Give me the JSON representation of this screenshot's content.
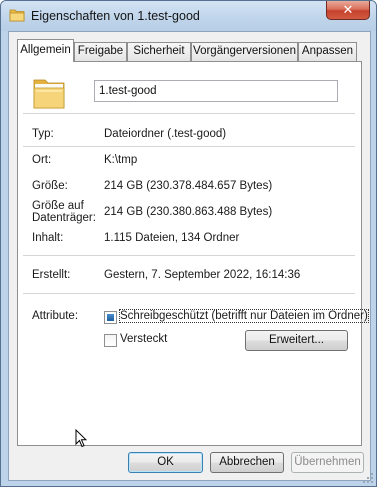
{
  "window": {
    "title": "Eigenschaften von 1.test-good",
    "close_glyph": "✕"
  },
  "tabs": [
    {
      "label": "Allgemein",
      "active": true
    },
    {
      "label": "Freigabe",
      "active": false
    },
    {
      "label": "Sicherheit",
      "active": false
    },
    {
      "label": "Vorgängerversionen",
      "active": false
    },
    {
      "label": "Anpassen",
      "active": false
    }
  ],
  "general": {
    "name_value": "1.test-good",
    "type_label": "Typ:",
    "type_value": "Dateiordner (.test-good)",
    "location_label": "Ort:",
    "location_value": "K:\\tmp",
    "size_label": "Größe:",
    "size_value": "214 GB (230.378.484.657 Bytes)",
    "size_on_disk_label_line1": "Größe auf",
    "size_on_disk_label_line2": "Datenträger:",
    "size_on_disk_value": "214 GB (230.380.863.488 Bytes)",
    "contents_label": "Inhalt:",
    "contents_value": "1.115 Dateien, 134 Ordner",
    "created_label": "Erstellt:",
    "created_value": "Gestern, 7. September 2022, 16:14:36",
    "attributes_label": "Attribute:",
    "readonly_label": "Schreibgeschützt (betrifft nur Dateien im Ordner)",
    "readonly_state": "indeterminate",
    "hidden_label": "Versteckt",
    "hidden_state": "unchecked",
    "advanced_button": "Erweitert..."
  },
  "buttons": {
    "ok": "OK",
    "cancel": "Abbrechen",
    "apply": "Übernehmen"
  },
  "icons": {
    "title_icon": "folder-icon",
    "large_icon": "folder-icon",
    "cursor": "mouse-pointer-icon"
  },
  "colors": {
    "title_bar": "#bfd4ea",
    "close_button": "#c5422c",
    "folder": "#f2cf6a",
    "checkbox_fill": "#1f5c9b"
  }
}
